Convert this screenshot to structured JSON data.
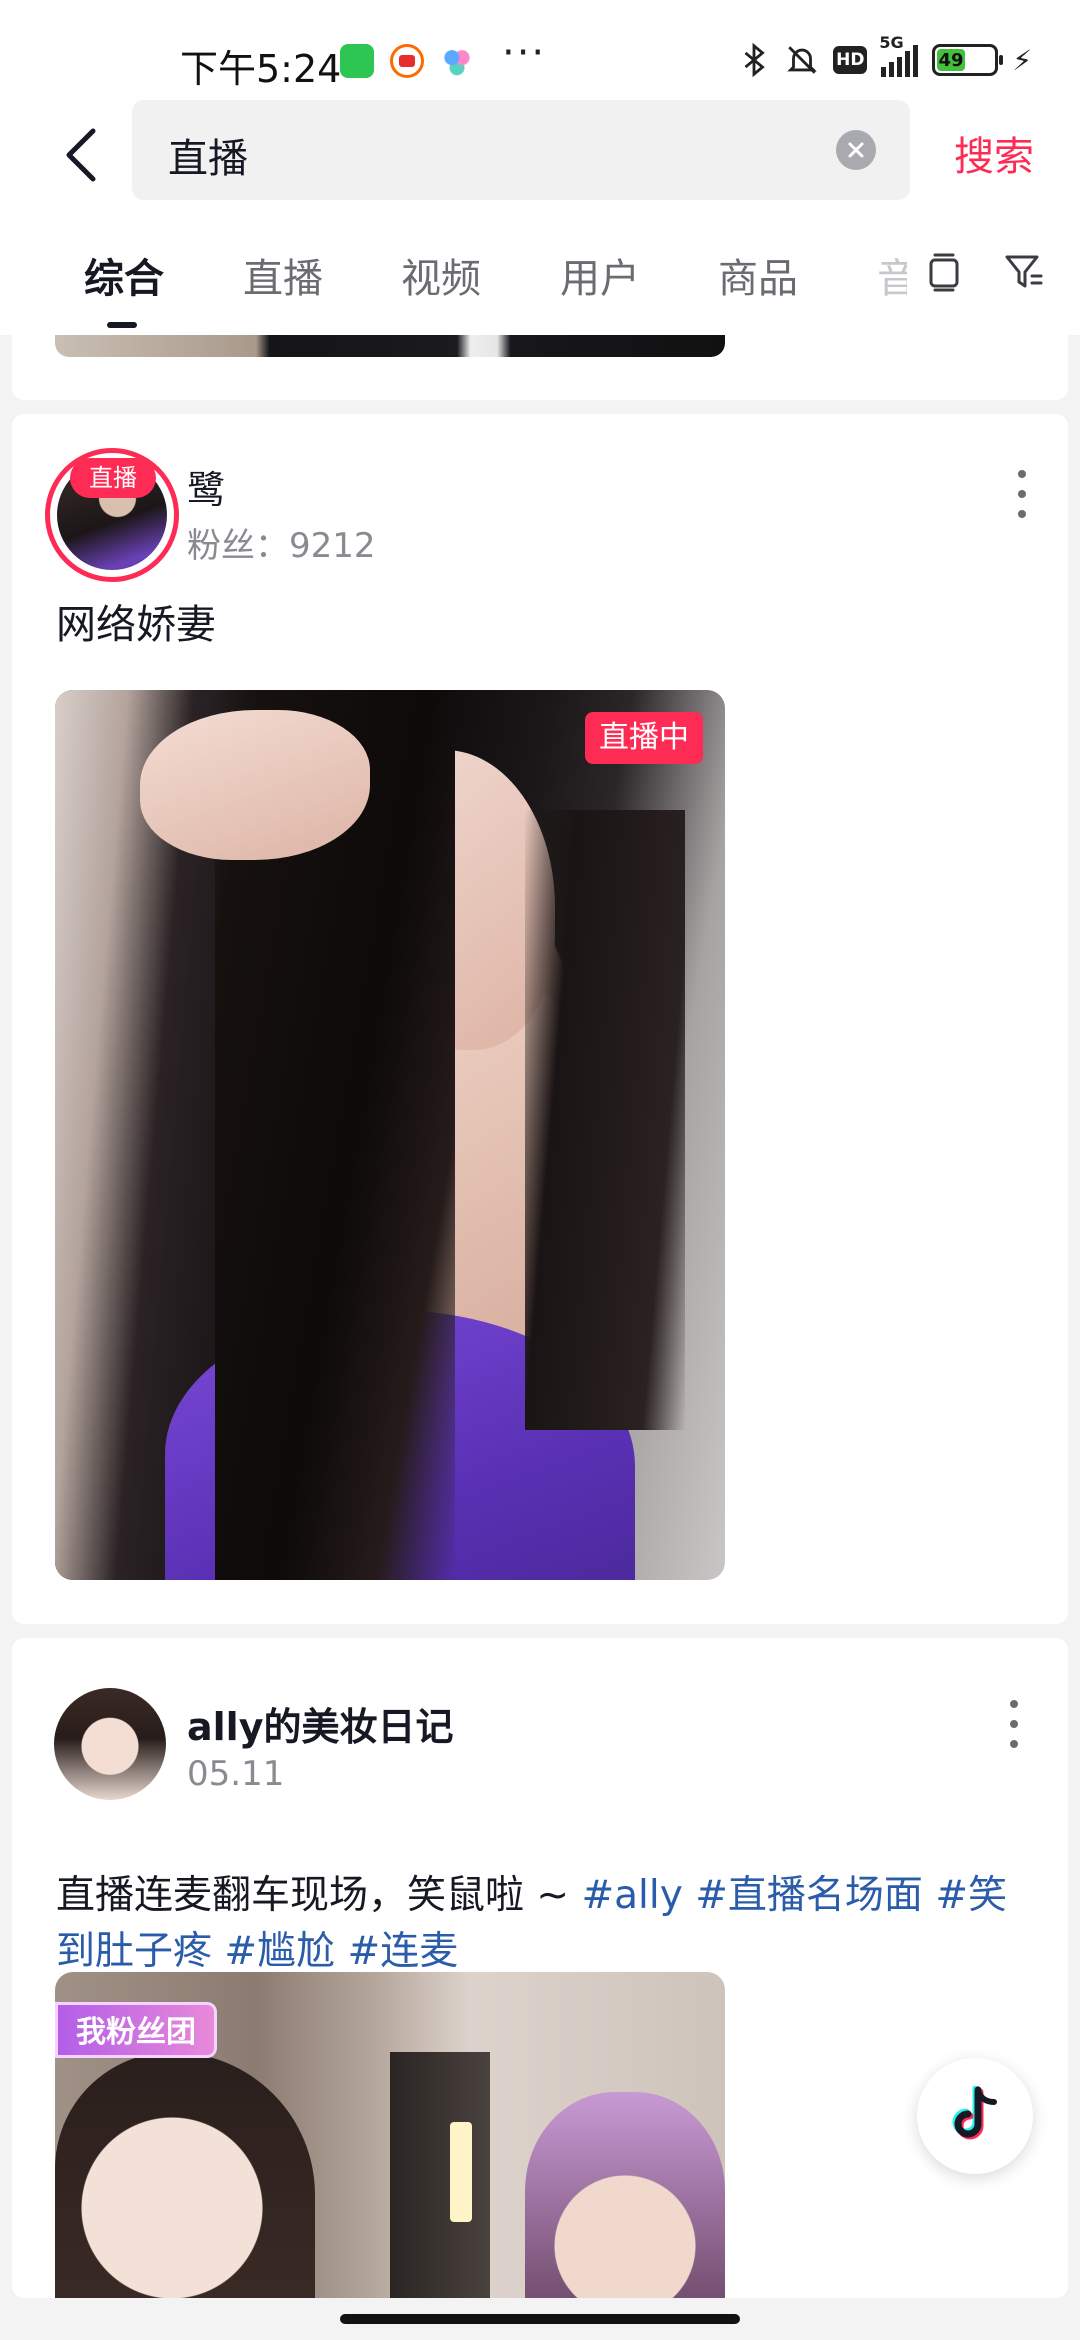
{
  "status_bar": {
    "time": "下午5:24",
    "network": "5G",
    "battery": "49",
    "battery_level": 0.49,
    "hd_label": "HD",
    "more": "···"
  },
  "search": {
    "query": "直播",
    "submit_label": "搜索"
  },
  "tabs": [
    {
      "label": "综合",
      "active": true
    },
    {
      "label": "直播"
    },
    {
      "label": "视频"
    },
    {
      "label": "用户"
    },
    {
      "label": "商品"
    },
    {
      "label": "音"
    }
  ],
  "posts": [
    {
      "user": "鹭",
      "fans": "粉丝：9212",
      "live_badge": "直播",
      "text": "网络娇妻",
      "media_badge": "直播中"
    },
    {
      "user": "ally的美妆日记",
      "date": "05.11",
      "text_line1": "直播连麦翻车现场，笑鼠啦 ~ ",
      "tags_line1": [
        "#ally",
        "#直播名场面",
        "#笑"
      ],
      "tags_line2": [
        "到肚子疼",
        "#尴尬",
        "#连麦"
      ],
      "media_badge": "我粉丝团"
    }
  ],
  "colors": {
    "accent": "#fe2c55",
    "hashtag": "#2a5caa",
    "text": "#161823",
    "muted": "#8a8b91"
  },
  "icons": {
    "back": "chevron-left-icon",
    "clear": "clear-circle-icon",
    "history": "history-icon",
    "filter": "filter-icon",
    "more": "vertical-dots-icon",
    "tiktok": "tiktok-icon"
  }
}
